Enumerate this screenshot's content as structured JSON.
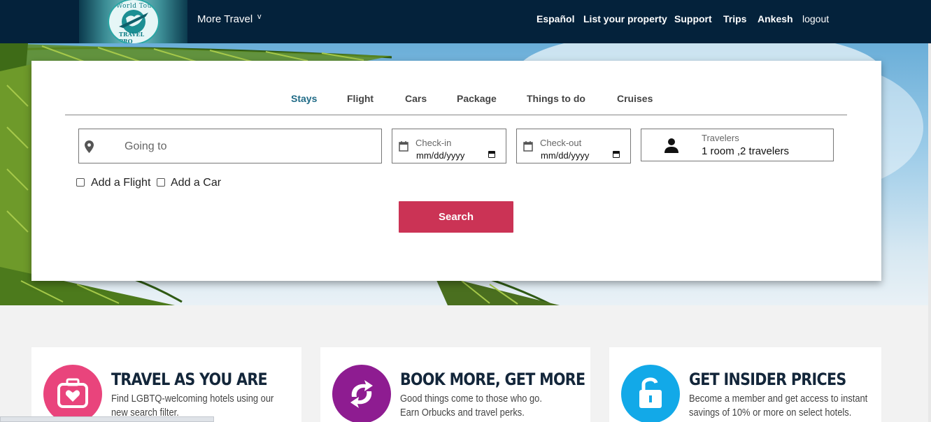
{
  "header": {
    "more_travel": "More Travel",
    "nav": [
      "Español",
      "List your property",
      "Support",
      "Trips",
      "Ankesh",
      "logout"
    ],
    "logo_text_top": "World Tour",
    "logo_text_bottom": "TRAVEL PRO",
    "bg_color": "#04223b"
  },
  "search": {
    "tabs": [
      "Stays",
      "Flight",
      "Cars",
      "Package",
      "Things to do",
      "Cruises"
    ],
    "active_tab": "Stays",
    "destination_placeholder": "Going to",
    "checkin_label": "Check-in",
    "checkin_value": "mm/dd/yyyy",
    "checkout_label": "Check-out",
    "checkout_value": "mm/dd/yyyy",
    "travelers_label": "Travelers",
    "travelers_value": "1 room ,2 travelers",
    "add_flight": "Add a Flight",
    "add_car": "Add a Car",
    "search_button": "Search",
    "accent_color": "#cb3355"
  },
  "promos": [
    {
      "title": "TRAVEL AS YOU ARE",
      "line1": "Find LGBTQ-welcoming hotels using our",
      "line2": "new search filter.",
      "color": "#e9447c",
      "icon": "suitcase-heart-icon"
    },
    {
      "title": "BOOK MORE, GET MORE",
      "line1": "Good things come to those who go.",
      "line2": "Earn Orbucks and travel perks.",
      "color": "#8e1c91",
      "icon": "refresh-arrows-icon"
    },
    {
      "title": "GET INSIDER PRICES",
      "line1": "Become a member and get access to instant",
      "line2": "savings of 10% or more on select hotels.",
      "color": "#12a9e8",
      "icon": "unlock-icon"
    }
  ]
}
